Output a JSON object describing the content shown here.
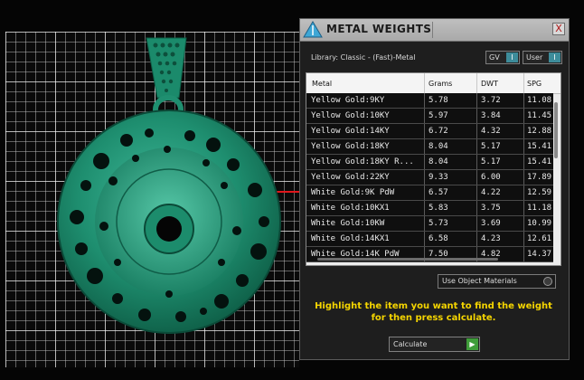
{
  "panel": {
    "title": "METAL WEIGHTS",
    "close_label": "X",
    "library_label": "Library: Classic - (Fast)-Metal",
    "toggles": [
      {
        "label": "GV",
        "indicator": "I"
      },
      {
        "label": "User",
        "indicator": "I"
      }
    ],
    "columns": [
      "Metal",
      "Grams",
      "DWT",
      "SPG"
    ],
    "rows": [
      {
        "metal": "Yellow Gold:9KY",
        "grams": "5.78",
        "dwt": "3.72",
        "spg": "11.08"
      },
      {
        "metal": "Yellow Gold:10KY",
        "grams": "5.97",
        "dwt": "3.84",
        "spg": "11.45"
      },
      {
        "metal": "Yellow Gold:14KY",
        "grams": "6.72",
        "dwt": "4.32",
        "spg": "12.88"
      },
      {
        "metal": "Yellow Gold:18KY",
        "grams": "8.04",
        "dwt": "5.17",
        "spg": "15.41"
      },
      {
        "metal": "Yellow Gold:18KY R...",
        "grams": "8.04",
        "dwt": "5.17",
        "spg": "15.41"
      },
      {
        "metal": "Yellow Gold:22KY",
        "grams": "9.33",
        "dwt": "6.00",
        "spg": "17.89"
      },
      {
        "metal": "White Gold:9K PdW",
        "grams": "6.57",
        "dwt": "4.22",
        "spg": "12.59"
      },
      {
        "metal": "White Gold:10KX1",
        "grams": "5.83",
        "dwt": "3.75",
        "spg": "11.18"
      },
      {
        "metal": "White Gold:10KW",
        "grams": "5.73",
        "dwt": "3.69",
        "spg": "10.99"
      },
      {
        "metal": "White Gold:14KX1",
        "grams": "6.58",
        "dwt": "4.23",
        "spg": "12.61"
      },
      {
        "metal": "White Gold:14K PdW",
        "grams": "7.50",
        "dwt": "4.82",
        "spg": "14.37"
      }
    ],
    "object_materials_label": "Use Object Materials",
    "instructions": "Highlight the item you want to find the weight for then press calculate.",
    "calculate_label": "Calculate",
    "calculate_indicator": "▶"
  },
  "colors": {
    "accent_yellow": "#f5d500",
    "pendant_green": "#1b8a6b",
    "toggle_blue": "#3d8c9a",
    "go_green": "#3f9d3a",
    "axis_red": "#e0161c"
  }
}
